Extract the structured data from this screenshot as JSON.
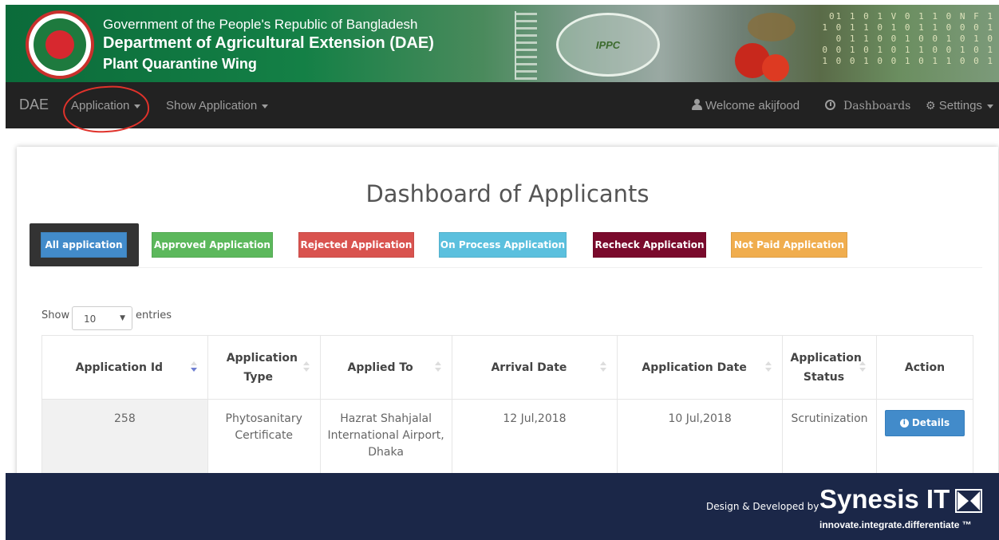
{
  "banner": {
    "line1": "Government of the People's Republic of Bangladesh",
    "line2": "Department of Agricultural Extension (DAE)",
    "line3": "Plant Quarantine Wing",
    "ippc_label": "IPPC",
    "binary_rows": [
      "01 1 0 1 V 0 1 1 0 N F 1",
      "1 0 1 1 0 1 0 1 1 0 0 0 1",
      "0 1 1 0 0 1 0 0 1 0 1 0",
      "0 0 1 0 1 0 1 1 0 0 1 0 1",
      "1 0 0 1 0 0 1 0 1 1 0 0 1"
    ],
    "colors": {
      "primary_green": "#148046"
    }
  },
  "navbar": {
    "brand": "DAE",
    "application": "Application",
    "show_application": "Show Application",
    "welcome": "Welcome akijfood",
    "dashboards": "Dashboards",
    "settings": "Settings",
    "icons": {
      "welcome": "user-icon",
      "dashboards": "clock-icon",
      "settings": "gear-icon"
    }
  },
  "page": {
    "title": "Dashboard of Applicants",
    "tabs": [
      {
        "label": "All application",
        "color": "#428bca",
        "active": true
      },
      {
        "label": "Approved Application",
        "color": "#5cb85c"
      },
      {
        "label": "Rejected Application",
        "color": "#d9534f"
      },
      {
        "label": "On Process Application",
        "color": "#5bc0de"
      },
      {
        "label": "Recheck Application",
        "color": "#7a0a2c"
      },
      {
        "label": "Not Paid Application",
        "color": "#f0ad4e"
      }
    ]
  },
  "table": {
    "show_label": "Show",
    "entries_label": "entries",
    "page_size": "10",
    "headers": {
      "id": "Application Id",
      "type": "Application Type",
      "applied_to": "Applied To",
      "arrival": "Arrival Date",
      "app_date": "Application Date",
      "status": "Application Status",
      "action": "Action"
    },
    "rows": [
      {
        "id": "258",
        "type": "Phytosanitary Certificate",
        "applied_to": "Hazrat Shahjalal International Airport, Dhaka",
        "arrival": "12 Jul,2018",
        "app_date": "10 Jul,2018",
        "status": "Scrutinization",
        "action": "Details"
      }
    ]
  },
  "footer": {
    "credit": "Design & Developed by",
    "company": "Synesis IT",
    "tagline": "innovate.integrate.differentiate ™"
  }
}
